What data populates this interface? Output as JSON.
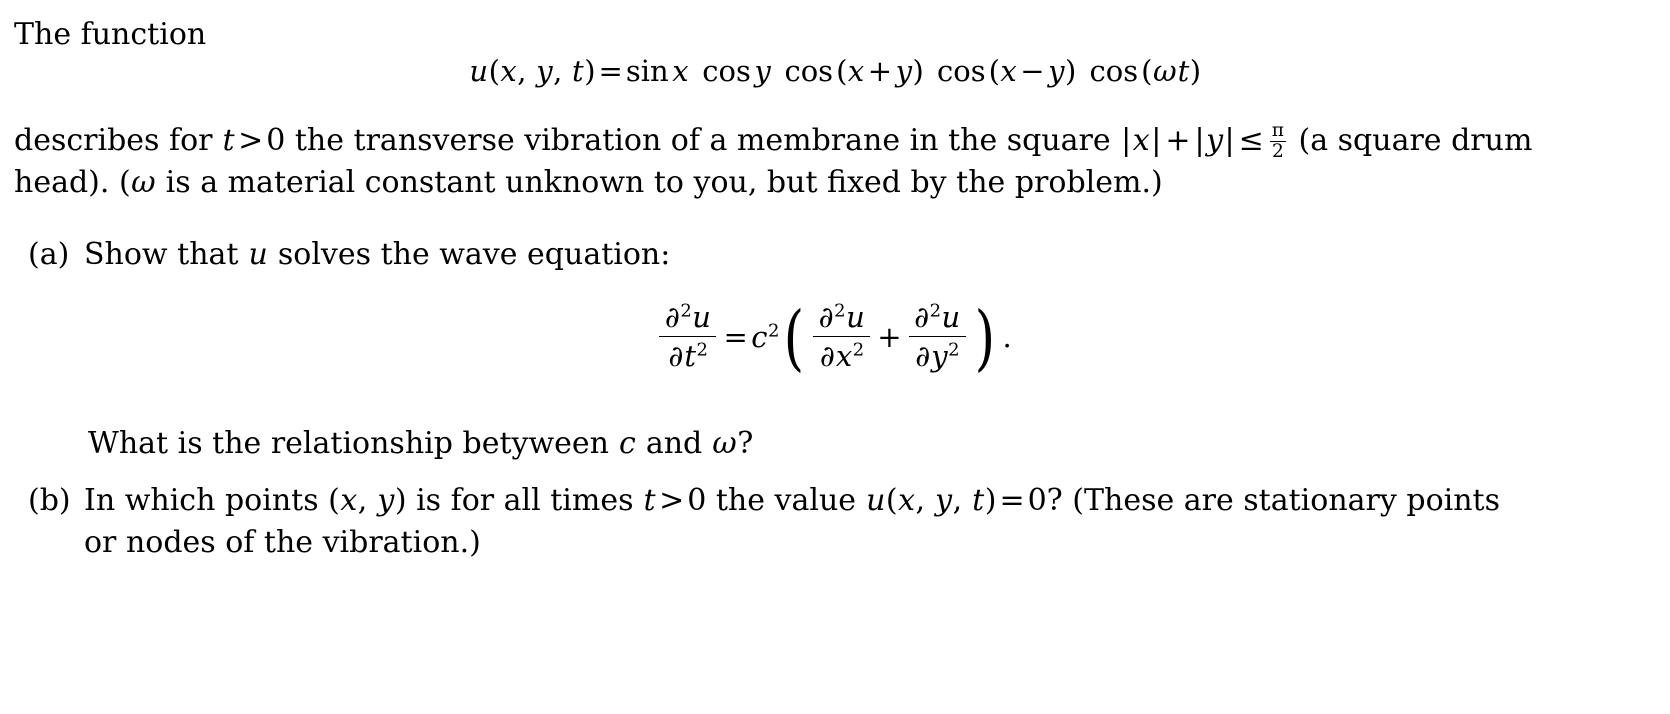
{
  "document": {
    "intro_text": "The function",
    "main_equation": {
      "lhs_func": "u",
      "lhs_args": "(x, y, t)",
      "equals": "=",
      "rhs": "sin x cos y cos(x + y) cos(x − y) cos(ωt)",
      "plain": "u(x, y, t) = sin x cos y cos(x + y) cos(x − y) cos(ωt)",
      "op_sin": "sin",
      "op_cos": "cos",
      "var_x": "x",
      "var_y": "y",
      "var_t": "t",
      "var_omega": "ω",
      "plus": "+",
      "minus": "−"
    },
    "paragraph": {
      "part1": "describes for ",
      "cond_t": "t",
      "cond_gt": ">",
      "cond_zero": "0",
      "part2": " the transverse vibration of a membrane in the square ",
      "abs_x": "x",
      "abs_plus": "+",
      "abs_y": "y",
      "leq": "≤",
      "frac_num": "π",
      "frac_den": "2",
      "part3": " (a square drum head). (",
      "omega": "ω",
      "part4": " is a material constant unknown to you, but fixed by the problem.)"
    },
    "items": [
      {
        "label": "(a)",
        "text_before_math": "Show that ",
        "math_u": "u",
        "text_after_math": " solves the wave equation:"
      },
      {
        "label": "(b)",
        "line1_a": "In which points ",
        "line1_pts": "(x, y)",
        "line1_b": " is for all times ",
        "line1_t": "t",
        "line1_gt": ">",
        "line1_zero": "0",
        "line1_c": " the value ",
        "line1_u": "u(x, y, t)",
        "line1_eq": "=",
        "line1_val": "0?",
        "line1_d": "  (These are stationary points",
        "line2": "or nodes of the vibration.)"
      }
    ],
    "wave_equation": {
      "lhs_num_partial": "∂",
      "lhs_num_sup": "2",
      "lhs_num_var": "u",
      "lhs_den_partial": "∂",
      "lhs_den_var": "t",
      "lhs_den_sup": "2",
      "equals": "=",
      "coeff": "c",
      "coeff_sup": "2",
      "open_paren": "(",
      "term1_num_partial": "∂",
      "term1_num_sup": "2",
      "term1_num_var": "u",
      "term1_den_partial": "∂",
      "term1_den_var": "x",
      "term1_den_sup": "2",
      "plus": "+",
      "term2_num_partial": "∂",
      "term2_num_sup": "2",
      "term2_num_var": "u",
      "term2_den_partial": "∂",
      "term2_den_var": "y",
      "term2_den_sup": "2",
      "close_paren": ")",
      "period": ".",
      "plain": "∂²u/∂t² = c² ( ∂²u/∂x² + ∂²u/∂y² )."
    },
    "relationship_question": {
      "text_before": "What is the relationship betyween ",
      "var_c": "c",
      "text_and": " and ",
      "var_omega": "ω",
      "question_mark": "?"
    }
  },
  "style": {
    "background": "#ffffff",
    "text_color": "#000000"
  }
}
